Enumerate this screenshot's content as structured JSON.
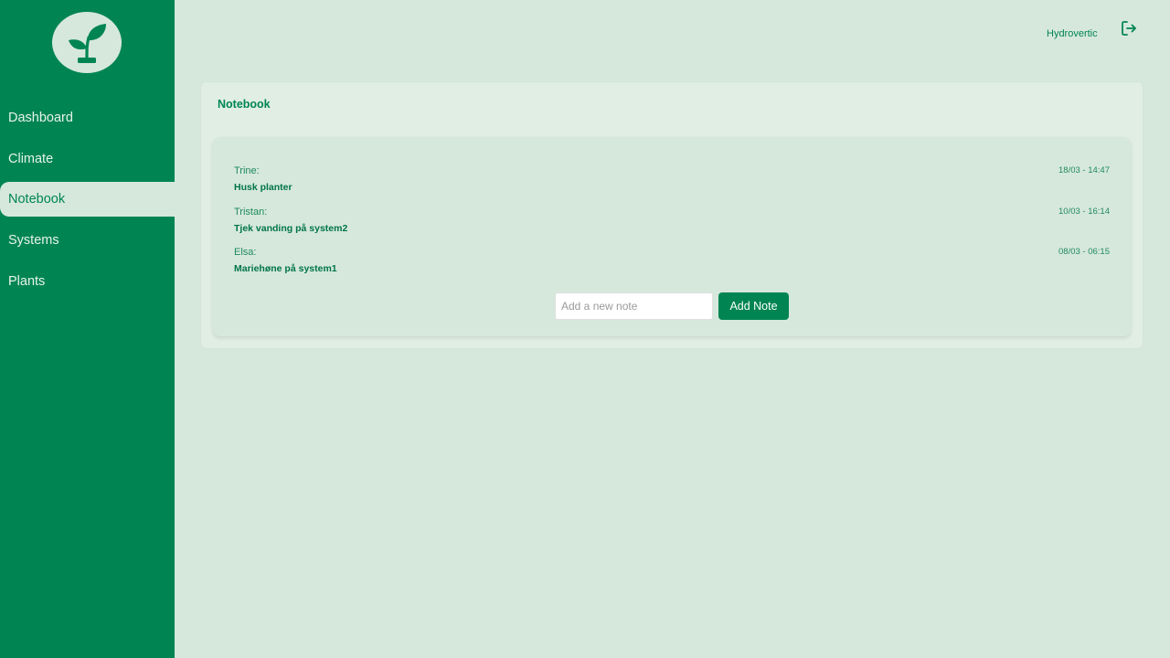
{
  "app": {
    "brand_name": "Hydrovertic",
    "logo_icon": "sprout-icon",
    "logout_icon": "logout-icon",
    "colors": {
      "primary": "#008552",
      "background": "#d6e8db",
      "panel": "#e0eee3"
    }
  },
  "sidebar": {
    "items": [
      {
        "label": "Dashboard",
        "active": false
      },
      {
        "label": "Climate",
        "active": false
      },
      {
        "label": "Notebook",
        "active": true
      },
      {
        "label": "Systems",
        "active": false
      },
      {
        "label": "Plants",
        "active": false
      }
    ]
  },
  "notebook": {
    "title": "Notebook",
    "notes": [
      {
        "author": "Trine:",
        "text": "Husk planter",
        "timestamp": "18/03 - 14:47"
      },
      {
        "author": "Tristan:",
        "text": "Tjek vanding på system2",
        "timestamp": "10/03 - 16:14"
      },
      {
        "author": "Elsa:",
        "text": "Mariehøne på system1",
        "timestamp": "08/03 - 06:15"
      }
    ],
    "input": {
      "placeholder": "Add a new note",
      "value": ""
    },
    "add_button_label": "Add Note"
  }
}
